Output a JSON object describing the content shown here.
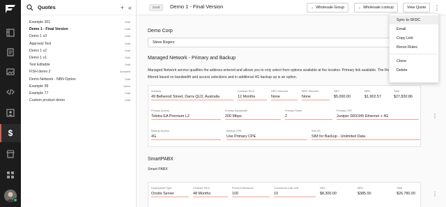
{
  "rail": {
    "icons": [
      "dashboard-icon",
      "folder-icon",
      "document-icon",
      "gallery-icon",
      "code-icon",
      "contact-card-icon",
      "dollar-icon",
      "store-icon",
      "grid-icon"
    ]
  },
  "quotes_panel": {
    "title": "Quotes",
    "add_symbol": "+",
    "collapse_symbol": "«",
    "items": [
      {
        "name": "Example 301",
        "status": "Draft"
      },
      {
        "name": "Demo 1 - Final Version",
        "status": "Draft"
      },
      {
        "name": "Demo 1 v3",
        "status": "Draft"
      },
      {
        "name": "Approval Test",
        "status": "Draft"
      },
      {
        "name": "Demo 1 v2",
        "status": "Draft"
      },
      {
        "name": "Demo 1 v1",
        "status": "Draft"
      },
      {
        "name": "Test Editable",
        "status": "Draft"
      },
      {
        "name": "FISH demo 2",
        "status": "Accepted"
      },
      {
        "name": "Demo Network - NBN Option",
        "status": "Draft"
      },
      {
        "name": "Example 99",
        "status": "Active"
      },
      {
        "name": "Example 77",
        "status": "Draft"
      },
      {
        "name": "Custom product demo",
        "status": "Draft"
      }
    ]
  },
  "topbar": {
    "badge": "Draft",
    "title": "Demo 1 - Final Version",
    "wholesale_group": "Wholesale Group",
    "wholesale_lookup": "Wholesale Lookup",
    "view_quote": "View Quote",
    "more": "⋮"
  },
  "account": {
    "name": "Demo Corp",
    "contact": "Steve Rogers"
  },
  "managed_network": {
    "title": "Managed Network - Primary and Backup",
    "description": "Managed Network service qualifies the address entered and allows you to only select from options available at the location. Primary link available. The Router is filtered based on bandwidth and access selections and in additional 4G backup up is an option.",
    "row1": [
      {
        "label": "Address",
        "value": "49 Bellwood Street, Darra QLD, Australia"
      },
      {
        "label": "Contract Term",
        "value": "12 Months"
      },
      {
        "label": "NRC Discount",
        "value": "None"
      },
      {
        "label": "MRC Discount",
        "value": "None"
      },
      {
        "label": "NRC",
        "value": "$5,000.00"
      },
      {
        "label": "MRC",
        "value": "$1,902.57"
      },
      {
        "label": "Total",
        "value": "$27,830.86"
      }
    ],
    "row2": [
      {
        "label": "Primary Access",
        "value": "Telstra EA Premium L2"
      },
      {
        "label": "Primary Bandwidth",
        "value": "200 Mbps"
      },
      {
        "label": "Primary Route",
        "value": "2"
      },
      {
        "label": "Primary CPE",
        "value": "Juniper SRX345 Ethernet + 4G"
      }
    ],
    "row3": [
      {
        "label": "Backup Access",
        "value": "4G"
      },
      {
        "label": "Backup CPE",
        "value": "Use Primary CPE"
      },
      {
        "label": "SIM 4G",
        "value": "SIM for Backup - Unlimited Data"
      }
    ]
  },
  "smartpabx": {
    "title": "SmartPABX",
    "subtitle": "Smart PABX",
    "row1": [
      {
        "label": "Deployment Type",
        "value": "Onsite Server"
      },
      {
        "label": "Contract Term",
        "value": "48 Months"
      },
      {
        "label": "Phone Extensions",
        "value": "100"
      },
      {
        "label": "Concurrent Call Limit",
        "value": "10"
      },
      {
        "label": "NRC",
        "value": "$8,300.00"
      },
      {
        "label": "MRC",
        "value": "$385.00"
      },
      {
        "label": "Total",
        "value": "$26,780.00"
      }
    ]
  },
  "menu": {
    "items": [
      "Sync to SFDC",
      "Email",
      "Copy Link",
      "Rerun Rules",
      "Clone",
      "Delete"
    ]
  }
}
